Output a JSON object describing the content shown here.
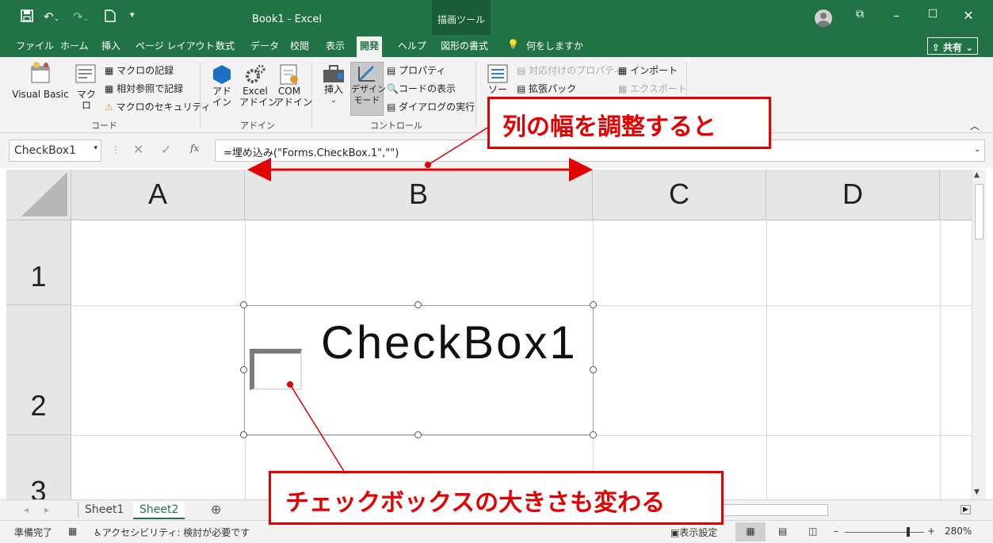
{
  "window": {
    "title": "Book1  -  Excel",
    "context_tab": "描画ツール",
    "colors": {
      "accent": "#217346",
      "annotation": "#e30000"
    }
  },
  "tabs": [
    "ファイル",
    "ホーム",
    "挿入",
    "ページ レイアウト",
    "数式",
    "データ",
    "校閲",
    "表示",
    "開発",
    "ヘルプ",
    "図形の書式"
  ],
  "active_tab": "開発",
  "tell_me": "何をしますか",
  "share": "共有",
  "ribbon": {
    "code": {
      "visual_basic": "Visual Basic",
      "macro": "マクロ",
      "record_macro": "マクロの記録",
      "relative_ref": "相対参照で記録",
      "macro_security": "マクロのセキュリティ",
      "group": "コード"
    },
    "addins": {
      "addins": "アド\nイン",
      "excel_addins": "Excel\nアドイン",
      "com_addins": "COM\nアドイン",
      "group": "アドイン"
    },
    "controls": {
      "insert": "挿入",
      "design_mode": "デザイン\nモード",
      "properties": "プロパティ",
      "view_code": "コードの表示",
      "run_dialog": "ダイアログの実行",
      "group": "コントロール"
    },
    "xml": {
      "source": "ソース",
      "map_properties": "対応付けのプロパティ",
      "expansion_packs": "拡張パック",
      "import": "インポート",
      "export": "エクスポート"
    }
  },
  "formula_bar": {
    "name_box": "CheckBox1",
    "formula": "=埋め込み(\"Forms.CheckBox.1\",\"\")"
  },
  "columns": [
    "A",
    "B",
    "C",
    "D"
  ],
  "rows": [
    "1",
    "2",
    "3"
  ],
  "checkbox_label": "CheckBox1",
  "sheets": [
    "Sheet1",
    "Sheet2"
  ],
  "active_sheet": "Sheet2",
  "status": {
    "ready": "準備完了",
    "accessibility": "アクセシビリティ: 検討が必要です",
    "display_settings": "表示設定",
    "zoom": "280%"
  },
  "annotations": {
    "callout1": "列の幅を調整すると",
    "callout2": "チェックボックスの大きさも変わる"
  }
}
